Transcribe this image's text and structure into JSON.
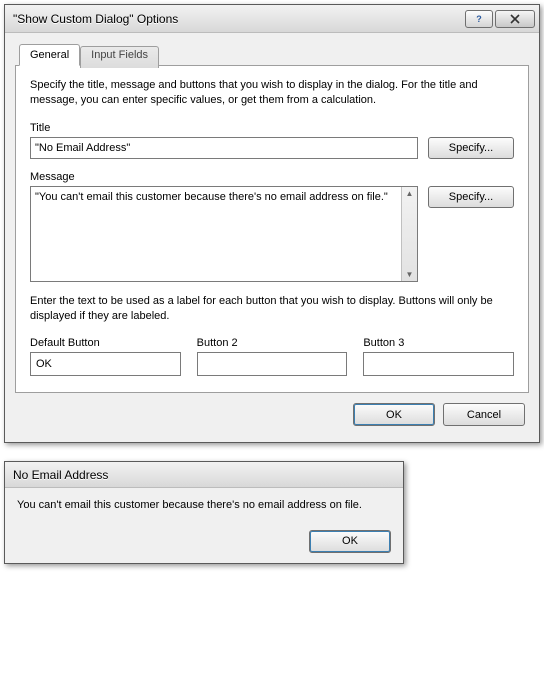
{
  "options_window": {
    "title": "\"Show Custom Dialog\" Options",
    "tabs": {
      "general": "General",
      "input_fields": "Input Fields"
    },
    "description": "Specify the title, message and buttons that you wish to display in the dialog.  For the title and message, you can enter specific values, or get them from a calculation.",
    "title_section": {
      "label": "Title",
      "value": "\"No Email Address\"",
      "specify": "Specify..."
    },
    "message_section": {
      "label": "Message",
      "value": "\"You can't email this customer because there's no email address on file.\"",
      "specify": "Specify..."
    },
    "button_help": "Enter the text to be used as a label for each button that you wish to display. Buttons will only be displayed if they are labeled.",
    "buttons": {
      "default_label": "Default Button",
      "default_value": "OK",
      "b2_label": "Button 2",
      "b2_value": "",
      "b3_label": "Button 3",
      "b3_value": ""
    },
    "footer": {
      "ok": "OK",
      "cancel": "Cancel"
    }
  },
  "result_dialog": {
    "title": "No Email Address",
    "message": "You can't email this customer because there's no email address on file.",
    "ok": "OK"
  }
}
